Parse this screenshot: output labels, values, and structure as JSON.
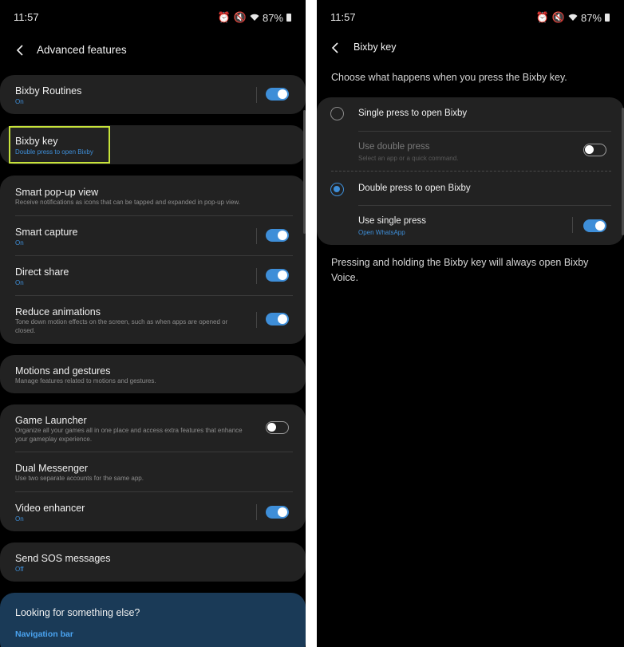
{
  "status": {
    "time": "11:57",
    "battery": "87%"
  },
  "left": {
    "header": {
      "title": "Advanced features"
    },
    "items": [
      {
        "title": "Bixby Routines",
        "subtitle": "On",
        "toggle": true
      },
      {
        "title": "Bixby key",
        "subtitle": "Double press to open Bixby",
        "highlighted": true
      },
      {
        "title": "Smart pop-up view",
        "subtitle": "Receive notifications as icons that can be tapped and expanded in pop-up view."
      },
      {
        "title": "Smart capture",
        "subtitle": "On",
        "toggle": true
      },
      {
        "title": "Direct share",
        "subtitle": "On",
        "toggle": true
      },
      {
        "title": "Reduce animations",
        "subtitle": "Tone down motion effects on the screen, such as when apps are opened or closed.",
        "toggle": true
      },
      {
        "title": "Motions and gestures",
        "subtitle": "Manage features related to motions and gestures."
      },
      {
        "title": "Game Launcher",
        "subtitle": "Organize all your games all in one place and access extra features that enhance your gameplay experience.",
        "toggle": false
      },
      {
        "title": "Dual Messenger",
        "subtitle": "Use two separate accounts for the same app."
      },
      {
        "title": "Video enhancer",
        "subtitle": "On",
        "toggle": true
      },
      {
        "title": "Send SOS messages",
        "subtitle": "Off"
      }
    ],
    "footer": {
      "title": "Looking for something else?",
      "link": "Navigation bar"
    }
  },
  "right": {
    "header": {
      "title": "Bixby key"
    },
    "intro": "Choose what happens when you press the Bixby key.",
    "options": [
      {
        "label": "Single press to open Bixby",
        "selected": false,
        "sub_title": "Use double press",
        "sub_subtitle": "Select an app or a quick command.",
        "sub_toggle": false
      },
      {
        "label": "Double press to open Bixby",
        "selected": true,
        "sub_title": "Use single press",
        "sub_subtitle": "Open WhatsApp",
        "sub_toggle": true
      }
    ],
    "note": "Pressing and holding the Bixby key will always open Bixby Voice."
  },
  "colors": {
    "accent": "#3e8ed8",
    "highlight": "#c7e33a",
    "card": "#222222"
  }
}
